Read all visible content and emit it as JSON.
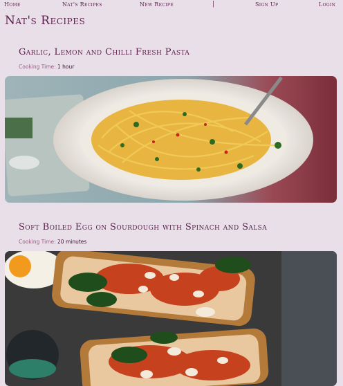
{
  "nav": {
    "home": "Home",
    "my_recipes": "Nat's Recipes",
    "new_recipe": "New Recipe",
    "separator": "|",
    "sign_up": "Sign Up",
    "login": "Login"
  },
  "site": {
    "title": "Nat's Recipes"
  },
  "recipes": [
    {
      "title": "Garlic, Lemon and Chilli Fresh Pasta",
      "cooking_time_label": "Cooking Time:",
      "cooking_time_value": "1 hour",
      "image_alt": "pasta-photo"
    },
    {
      "title": "Soft Boiled Egg on Sourdough with Spinach and Salsa",
      "cooking_time_label": "Cooking Time:",
      "cooking_time_value": "20 minutes",
      "image_alt": "toast-photo"
    }
  ],
  "colors": {
    "background": "#e8dfe8",
    "text_primary": "#5a1f4a",
    "label_muted": "#9a5b86"
  }
}
